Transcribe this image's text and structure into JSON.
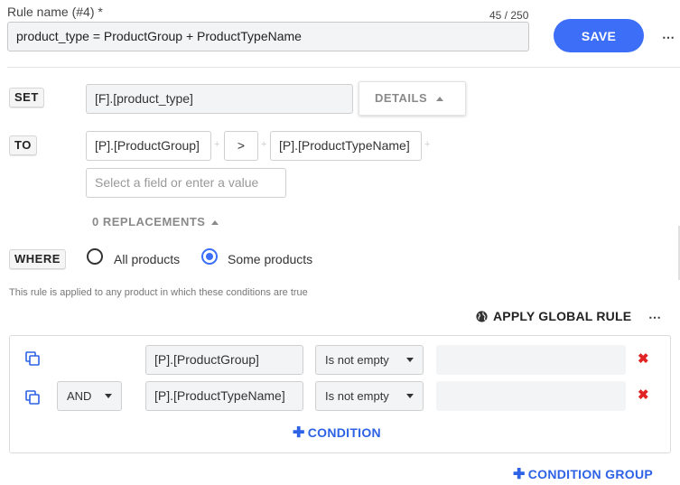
{
  "rule_name": {
    "label": "Rule name (#4) *",
    "counter": "45 / 250",
    "value": "product_type = ProductGroup + ProductTypeName"
  },
  "save_label": "SAVE",
  "more_icon": "⋯",
  "set": {
    "keyword": "SET",
    "field": "[F].[product_type]",
    "details_label": "DETAILS"
  },
  "to": {
    "keyword": "TO",
    "parts": [
      "[P].[ProductGroup]",
      ">",
      "[P].[ProductTypeName]"
    ],
    "placeholder": "Select a field or enter a value",
    "plus": "+"
  },
  "replacements_label": "0 REPLACEMENTS",
  "where": {
    "keyword": "WHERE",
    "options": [
      "All products",
      "Some products"
    ],
    "selected": "Some products"
  },
  "note": "This rule is applied to any product in which these conditions are true",
  "apply_global_label": "APPLY GLOBAL RULE",
  "conditions": [
    {
      "connector": "",
      "field": "[P].[ProductGroup]",
      "operator": "Is not empty",
      "value": ""
    },
    {
      "connector": "AND",
      "field": "[P].[ProductTypeName]",
      "operator": "Is not empty",
      "value": ""
    }
  ],
  "remove_icon": "✖",
  "add_condition_label": "CONDITION",
  "add_group_label": "CONDITION GROUP",
  "plus_icon": "✚",
  "colors": {
    "accent": "#3d6ef7",
    "link": "#2d62e6",
    "danger": "#e02424"
  }
}
